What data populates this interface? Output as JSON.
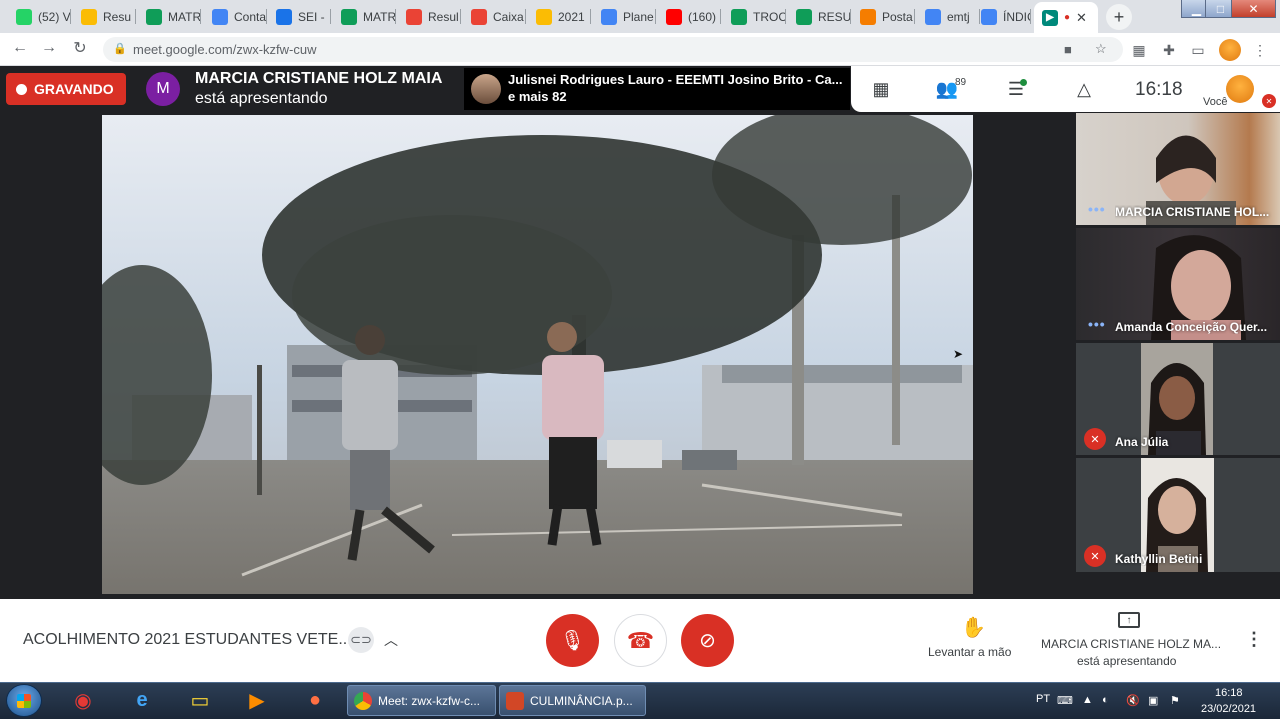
{
  "browser": {
    "tabs": [
      {
        "label": "(52) V",
        "icon": "whatsapp-icon",
        "color": "#25d366"
      },
      {
        "label": "Resu",
        "icon": "google-drive-icon",
        "color": "#fbbc04"
      },
      {
        "label": "MATR",
        "icon": "google-sheets-icon",
        "color": "#0f9d58"
      },
      {
        "label": "Conta",
        "icon": "account-icon",
        "color": "#4285f4"
      },
      {
        "label": "SEI -",
        "icon": "sei-icon",
        "color": "#1a73e8"
      },
      {
        "label": "MATR",
        "icon": "google-sheets-icon",
        "color": "#0f9d58"
      },
      {
        "label": "Resul",
        "icon": "gmail-icon",
        "color": "#ea4335"
      },
      {
        "label": "Caixa",
        "icon": "gmail-icon",
        "color": "#ea4335"
      },
      {
        "label": "2021",
        "icon": "google-drive-icon",
        "color": "#fbbc04"
      },
      {
        "label": "Plane",
        "icon": "google-docs-icon",
        "color": "#4285f4"
      },
      {
        "label": "(160)",
        "icon": "youtube-icon",
        "color": "#ff0000"
      },
      {
        "label": "TROC",
        "icon": "google-sheets-icon",
        "color": "#0f9d58"
      },
      {
        "label": "RESU",
        "icon": "google-sheets-icon",
        "color": "#0f9d58"
      },
      {
        "label": "Posta",
        "icon": "blogger-icon",
        "color": "#f57d00"
      },
      {
        "label": "emtj",
        "icon": "google-calendar-icon",
        "color": "#4285f4"
      },
      {
        "label": "ÍNDIC",
        "icon": "google-docs-icon",
        "color": "#4285f4"
      }
    ],
    "active_tab_close": "✕",
    "url": "meet.google.com/zwx-kzfw-cuw"
  },
  "meet": {
    "recording_label": "GRAVANDO",
    "presenter_initial": "M",
    "presenter_name": "MARCIA CRISTIANE HOLZ MAIA",
    "presenter_sub": "está apresentando",
    "other_participant": "Julisnei Rodrigues Lauro - EEEMTI Josino Brito - Ca...",
    "other_more": "e mais 82",
    "participant_count": "89",
    "clock": "16:18",
    "self_label": "Você",
    "tiles": [
      {
        "name": "MARCIA CRISTIANE HOL...",
        "status": "speaking"
      },
      {
        "name": "Amanda Conceição Quer...",
        "status": "speaking"
      },
      {
        "name": "Ana Júlia",
        "status": "muted"
      },
      {
        "name": "Kathyllin Betini",
        "status": "muted"
      }
    ],
    "meeting_title": "ACOLHIMENTO 2021 ESTUDANTES VETE...",
    "raise_hand_label": "Levantar a mão",
    "presenting_name": "MARCIA CRISTIANE HOLZ MA...",
    "presenting_sub": "está apresentando"
  },
  "taskbar": {
    "buttons": [
      {
        "label": "Meet: zwx-kzfw-c...",
        "icon": "chrome-icon"
      },
      {
        "label": "CULMINÂNCIA.p...",
        "icon": "powerpoint-icon"
      }
    ],
    "language": "PT",
    "time": "16:18",
    "date": "23/02/2021"
  },
  "colors": {
    "accent_red": "#d93025",
    "meet_dark": "#202124",
    "presenter_avatar": "#7b1fa2"
  }
}
